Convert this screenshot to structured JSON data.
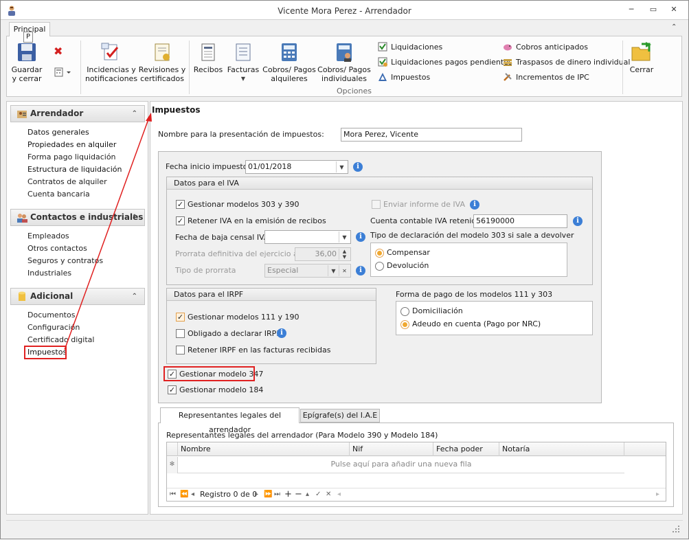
{
  "window": {
    "title": "Vicente Mora Perez - Arrendador"
  },
  "ribbon": {
    "tab": "Principal",
    "tab_key": "P",
    "buttons": {
      "guardar": "Guardar\ny cerrar",
      "incidencias": "Incidencias y\nnotificaciones",
      "revisiones": "Revisiones y\ncertificados",
      "recibos": "Recibos",
      "facturas": "Facturas",
      "cobros_alquileres": "Cobros/ Pagos\nalquileres",
      "cobros_individuales": "Cobros/ Pagos\nindividuales",
      "cerrar": "Cerrar"
    },
    "options_group": "Opciones",
    "options": [
      "Liquidaciones",
      "Liquidaciones pagos pendientes",
      "Impuestos",
      "Cobros anticipados",
      "Traspasos de dinero individual",
      "Incrementos de IPC"
    ]
  },
  "sidebar": {
    "groups": [
      {
        "title": "Arrendador",
        "items": [
          "Datos generales",
          "Propiedades en alquiler",
          "Forma pago liquidación",
          "Estructura de liquidación",
          "Contratos de alquiler",
          "Cuenta bancaria"
        ]
      },
      {
        "title": "Contactos e industriales",
        "items": [
          "Empleados",
          "Otros contactos",
          "Seguros y contratos",
          "Industriales"
        ]
      },
      {
        "title": "Adicional",
        "items": [
          "Documentos",
          "Configuración",
          "Certificado digital",
          "Impuestos"
        ]
      }
    ]
  },
  "main": {
    "title": "Impuestos",
    "nombre_label": "Nombre para la presentación de impuestos:",
    "nombre_value": "Mora Perez, Vicente",
    "fecha_label": "Fecha inicio impuestos:",
    "fecha_value": "01/01/2018",
    "iva": {
      "title": "Datos para el IVA",
      "gestionar": "Gestionar modelos 303 y 390",
      "retener": "Retener IVA en la emisión de recibos",
      "baja_label": "Fecha de baja censal IVA",
      "baja_value": "",
      "prorrata_label": "Prorrata definitiva del ejercicio anterior",
      "prorrata_value": "36,00",
      "tipo_label": "Tipo de prorrata",
      "tipo_value": "Especial",
      "enviar": "Enviar informe de IVA",
      "cuenta_label": "Cuenta contable IVA retenido:",
      "cuenta_value": "56190000",
      "tipo_decl_label": "Tipo de declaración del modelo 303 si sale a devolver",
      "compensar": "Compensar",
      "devolucion": "Devolución"
    },
    "irpf": {
      "title": "Datos para el IRPF",
      "gestionar": "Gestionar modelos 111 y 190",
      "obligado": "Obligado a declarar IRPF",
      "retener": "Retener IRPF en las facturas recibidas"
    },
    "forma_pago": {
      "title": "Forma de pago de los modelos 111 y 303",
      "domiciliacion": "Domiciliación",
      "adeudo": "Adeudo en cuenta (Pago por NRC)"
    },
    "modelo347": "Gestionar modelo 347",
    "modelo184": "Gestionar modelo 184",
    "tabs": [
      "Representantes legales del arrendador",
      "Epígrafe(s) del I.A.E"
    ],
    "grid": {
      "caption": "Representantes legales del arrendador (Para Modelo 390 y Modelo 184)",
      "columns": [
        "Nombre",
        "Nif",
        "Fecha poder",
        "Notaría"
      ],
      "new_row": "Pulse aquí para añadir una nueva fila",
      "new_row_marker": "✻",
      "nav_record": "Registro 0 de 0"
    }
  },
  "colors": {
    "highlight": "#e02020",
    "accent_radio": "#f0a830",
    "info": "#3c7fd6"
  }
}
